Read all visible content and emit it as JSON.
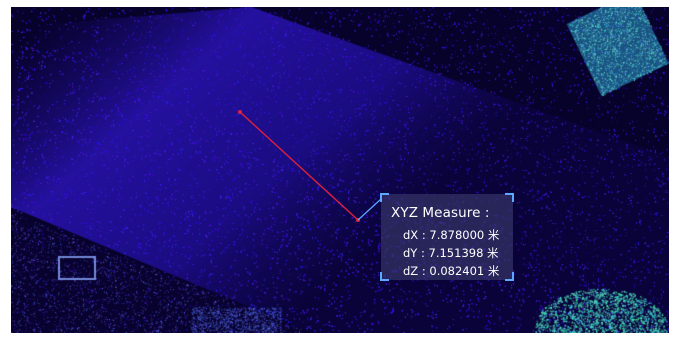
{
  "measure": {
    "title": "XYZ Measure :",
    "rows": [
      {
        "label": "dX",
        "value": "7.878000",
        "unit": "米"
      },
      {
        "label": "dY",
        "value": "7.151398",
        "unit": "米"
      },
      {
        "label": "dZ",
        "value": "0.082401",
        "unit": "米"
      }
    ]
  },
  "colors": {
    "measure_line": "#e0203a",
    "panel_bracket": "#5aa9ff",
    "cloud_high": "#3ad6c8",
    "cloud_base": "#2a10ff"
  }
}
